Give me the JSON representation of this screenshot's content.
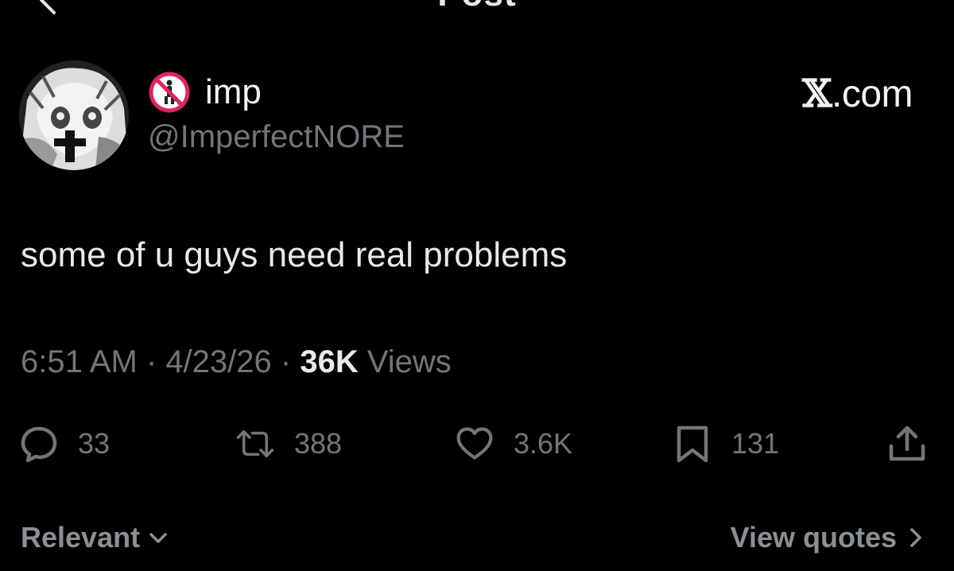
{
  "header": {
    "title": "Post",
    "back_icon": "chevron-left-icon",
    "more_icon": "more-horizontal-icon"
  },
  "author": {
    "display_name": "imp",
    "handle": "@ImperfectNORE",
    "badge_icon": "no-littering-icon",
    "avatar": "anime-avatar"
  },
  "brand": {
    "x_glyph": "𝕏",
    "suffix": ".com"
  },
  "post": {
    "text": "some of u guys need real problems"
  },
  "meta": {
    "time": "6:51 AM",
    "sep1": " · ",
    "date": "4/23/26",
    "sep2": " · ",
    "views_count": "36K",
    "views_label": " Views"
  },
  "actions": {
    "replies": {
      "icon": "reply-icon",
      "count": "33"
    },
    "reposts": {
      "icon": "repost-icon",
      "count": "388"
    },
    "likes": {
      "icon": "heart-icon",
      "count": "3.6K"
    },
    "bookmarks": {
      "icon": "bookmark-icon",
      "count": "131"
    },
    "share": {
      "icon": "share-icon"
    }
  },
  "footer": {
    "sort_label": "Relevant",
    "quotes_label": "View quotes"
  },
  "colors": {
    "background": "#000000",
    "text_primary": "#e7e9ea",
    "text_secondary": "#71767b",
    "badge_red": "#e0245e"
  }
}
